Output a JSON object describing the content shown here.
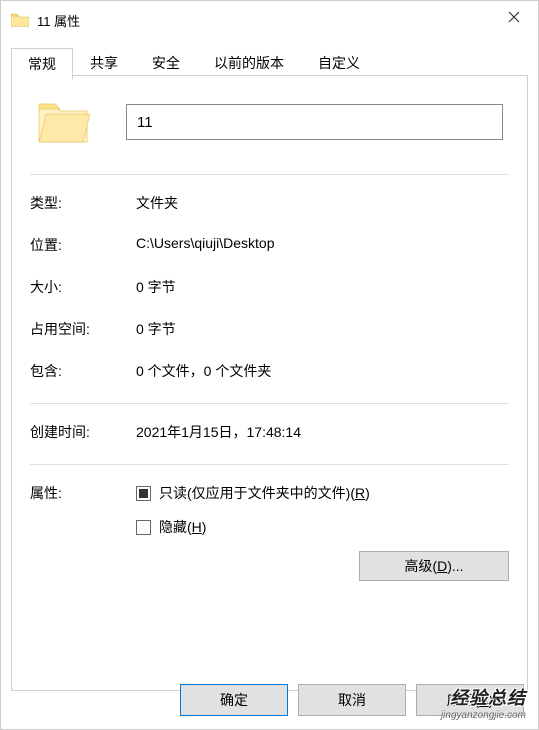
{
  "title": "11 属性",
  "tabs": {
    "general": "常规",
    "share": "共享",
    "security": "安全",
    "prev": "以前的版本",
    "custom": "自定义"
  },
  "folderName": "11",
  "labels": {
    "type": "类型:",
    "location": "位置:",
    "size": "大小:",
    "sizeOnDisk": "占用空间:",
    "contains": "包含:",
    "created": "创建时间:",
    "attributes": "属性:"
  },
  "values": {
    "type": "文件夹",
    "location": "C:\\Users\\qiuji\\Desktop",
    "size": "0 字节",
    "sizeOnDisk": "0 字节",
    "contains": "0 个文件，0 个文件夹",
    "created": "2021年1月15日，17:48:14"
  },
  "attr": {
    "readonlyPrefix": "只读(仅应用于文件夹中的文件)(",
    "readonlyKey": "R",
    "readonlySuffix": ")",
    "hiddenPrefix": "隐藏(",
    "hiddenKey": "H",
    "hiddenSuffix": ")",
    "advancedPrefix": "高级(",
    "advancedKey": "D",
    "advancedSuffix": ")..."
  },
  "buttons": {
    "ok": "确定",
    "cancel": "取消",
    "applyPrefix": "应用(",
    "applyKey": "A",
    "applySuffix": ")"
  },
  "watermark": {
    "main": "经验总结",
    "sub": "jingyanzongjie.com"
  }
}
